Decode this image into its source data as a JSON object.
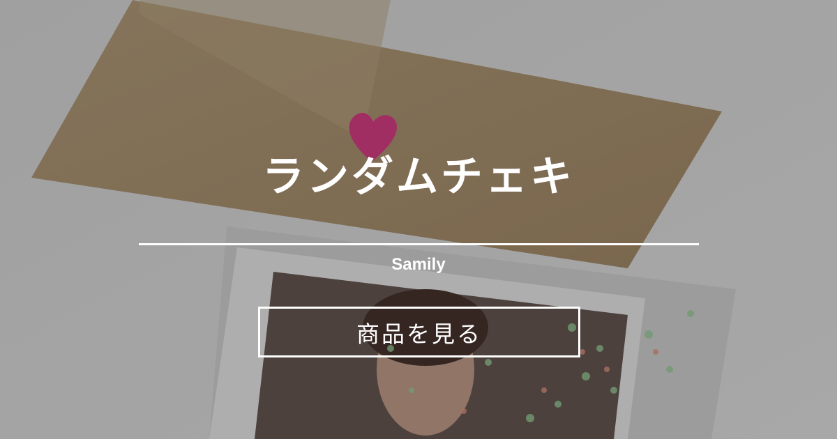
{
  "card": {
    "title": "ランダムチェキ",
    "shop_name": "Samily",
    "cta_label": "商品を見る"
  },
  "background": {
    "description_icons": [
      "heart-icon"
    ],
    "colors": {
      "envelope": "#b59c7a",
      "heart": "#e0408a",
      "wall": "#e4e4e4",
      "overlay": "rgba(0,0,0,0.28)",
      "text": "#ffffff"
    }
  }
}
